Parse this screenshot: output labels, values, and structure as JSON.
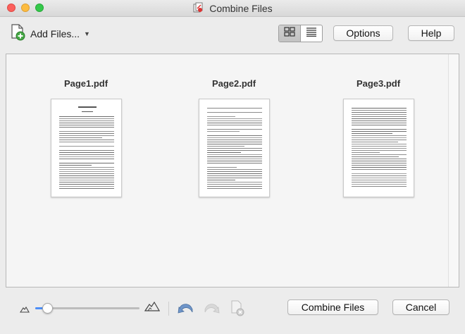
{
  "window": {
    "title": "Combine Files"
  },
  "toolbar": {
    "add_files_label": "Add Files...",
    "options_label": "Options",
    "help_label": "Help"
  },
  "files": [
    {
      "name": "Page1.pdf"
    },
    {
      "name": "Page2.pdf"
    },
    {
      "name": "Page3.pdf"
    }
  ],
  "bottom": {
    "zoom_level": 0.12,
    "combine_label": "Combine Files",
    "cancel_label": "Cancel"
  },
  "colors": {
    "accent": "#4c8ef7",
    "close": "#fc605c",
    "minimize": "#fdbc40",
    "maximize": "#34c84a"
  },
  "icons": {
    "add_files": "add-document-icon",
    "grid_view": "grid-view-icon",
    "list_view": "list-view-icon",
    "zoom_out": "small-mountain-icon",
    "zoom_in": "large-mountain-icon",
    "undo": "undo-arrow-icon",
    "redo": "redo-arrow-icon",
    "remove": "remove-document-icon"
  }
}
